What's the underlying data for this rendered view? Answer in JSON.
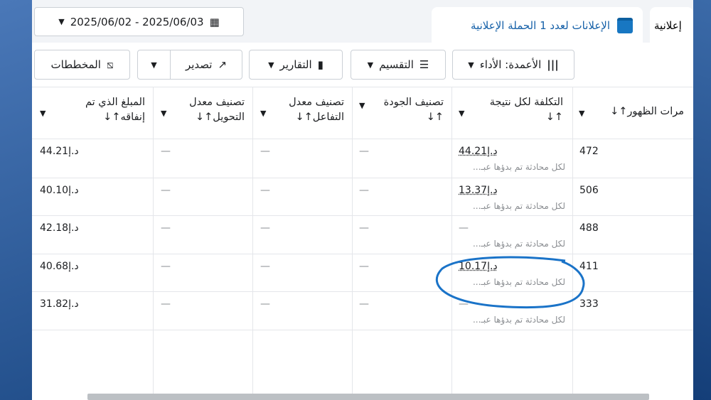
{
  "date_range": {
    "label": "2025/06/02 - 2025/06/03"
  },
  "tabs": [
    {
      "label": "الإعلانات لعدد 1 الحملة الإعلانية"
    },
    {
      "label": "إعلانية"
    }
  ],
  "toolbar": {
    "columns": "الأعمدة: الأداء",
    "breakdown": "التقسيم",
    "reports": "التقارير",
    "export": "تصدير",
    "charts": "المخططات"
  },
  "table": {
    "headers": {
      "impressions": "مرات الظهور↑↓",
      "cost_per_result": "التكلفة لكل نتيجة",
      "quality": "تصنيف الجودة",
      "engagement": "تصنيف معدل",
      "engagement2": "التفاعل↑↓",
      "conversion": "تصنيف معدل",
      "conversion2": "التحويل↑↓",
      "spent": "المبلغ الذي تم",
      "spent2": "إنفاقه↑↓",
      "sort": "↑↓"
    },
    "result_sub": "لكل محادثة تم بدؤها عبـ...",
    "dash": "—",
    "rows": [
      {
        "impressions": "472",
        "cost": "44.21د.إ",
        "spent": "44.21د.إ"
      },
      {
        "impressions": "506",
        "cost": "13.37د.إ",
        "spent": "40.10د.إ"
      },
      {
        "impressions": "488",
        "cost": "—",
        "spent": "42.18د.إ"
      },
      {
        "impressions": "411",
        "cost": "10.17د.إ",
        "spent": "40.68د.إ"
      },
      {
        "impressions": "333",
        "cost": "—",
        "spent": "31.82د.إ"
      }
    ]
  }
}
